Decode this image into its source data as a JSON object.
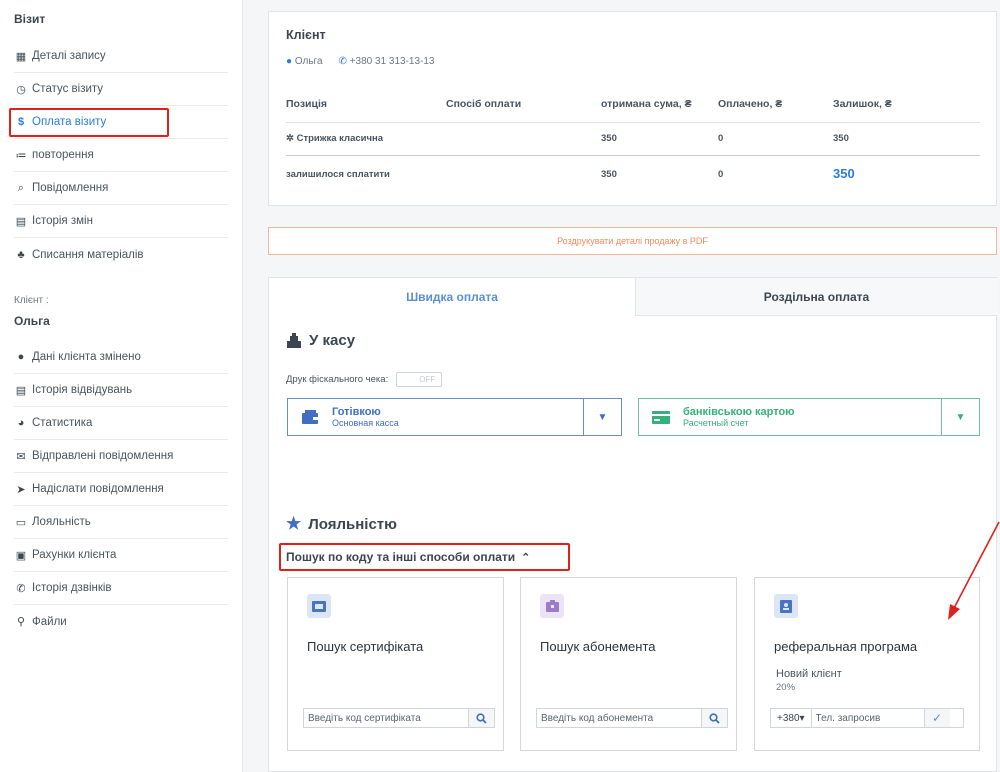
{
  "sidebar": {
    "section_title": "Візит",
    "visit_items": [
      {
        "icon": "calendar-icon",
        "glyph": "▦",
        "label": "Деталі запису"
      },
      {
        "icon": "clock-icon",
        "glyph": "◷",
        "label": "Статус візиту"
      },
      {
        "icon": "dollar-icon",
        "glyph": "$",
        "label": "Оплата візиту"
      },
      {
        "icon": "list-icon",
        "glyph": "≔",
        "label": "повторення"
      },
      {
        "icon": "chat-icon",
        "glyph": "⌕",
        "label": "Повідомлення"
      },
      {
        "icon": "file-icon",
        "glyph": "▤",
        "label": "Історія змін"
      },
      {
        "icon": "cubes-icon",
        "glyph": "♣",
        "label": "Списання матеріалів"
      }
    ],
    "client_label": "Клієнт :",
    "client_name": "Ольга",
    "client_items": [
      {
        "icon": "user-icon",
        "glyph": "●",
        "label": "Дані клієнта змінено"
      },
      {
        "icon": "history-list-icon",
        "glyph": "▤",
        "label": "Історія відвідувань"
      },
      {
        "icon": "pie-chart-icon",
        "glyph": "◕",
        "label": "Статистика"
      },
      {
        "icon": "envelope-icon",
        "glyph": "✉",
        "label": "Відправлені повідомлення"
      },
      {
        "icon": "paper-plane-icon",
        "glyph": "➤",
        "label": "Надіслати повідомлення"
      },
      {
        "icon": "credit-card-icon",
        "glyph": "▭",
        "label": "Лояльність"
      },
      {
        "icon": "briefcase-icon",
        "glyph": "▣",
        "label": "Рахунки клієнта"
      },
      {
        "icon": "phone-icon",
        "glyph": "✆",
        "label": "Історія дзвінків"
      },
      {
        "icon": "paperclip-icon",
        "glyph": "⚲",
        "label": "Файли"
      }
    ]
  },
  "client": {
    "title": "Клієнт",
    "name": "Ольга",
    "phone": "+380 31 313-13-13",
    "columns": [
      "Позиція",
      "Спосіб оплати",
      "отримана сума, ₴",
      "Оплачено, ₴",
      "Залишок, ₴"
    ],
    "rows": [
      {
        "position": "Стрижка класична",
        "received": "350",
        "paid": "0",
        "balance": "350"
      }
    ],
    "total": {
      "label": "залишилося сплатити",
      "received": "350",
      "paid": "0",
      "balance": "350"
    }
  },
  "pdf_button": "Роздрукувати деталі продажу в PDF",
  "tabs": {
    "quick": "Швидка оплата",
    "split": "Роздільна оплата"
  },
  "cashbox": {
    "title": "У касу",
    "fiscal_label": "Друк фіскального чека:",
    "fiscal_toggle": "OFF",
    "methods": [
      {
        "title": "Готівкою",
        "subtitle": "Основная касса"
      },
      {
        "title": "банківською картою",
        "subtitle": "Расчетный счет"
      }
    ]
  },
  "loyalty": {
    "title": "Лояльністю",
    "search_toggle": "Пошук по коду та інші способи оплати",
    "cards": [
      {
        "title": "Пошук сертифіката",
        "placeholder": "Введіть код сертифіката"
      },
      {
        "title": "Пошук абонемента",
        "placeholder": "Введіть код абонемента"
      },
      {
        "title": "реферальная програма",
        "subtitle": "Новий клієнт",
        "discount": "20%",
        "prefix": "+380▾",
        "placeholder": "Тел. запросив"
      }
    ]
  },
  "colors": {
    "accent_blue": "#2a7be0",
    "cash_blue": "#3f6ec2",
    "card_green": "#36b07a",
    "highlight_red": "#e0201c",
    "pdf_orange": "#f08a5d"
  }
}
